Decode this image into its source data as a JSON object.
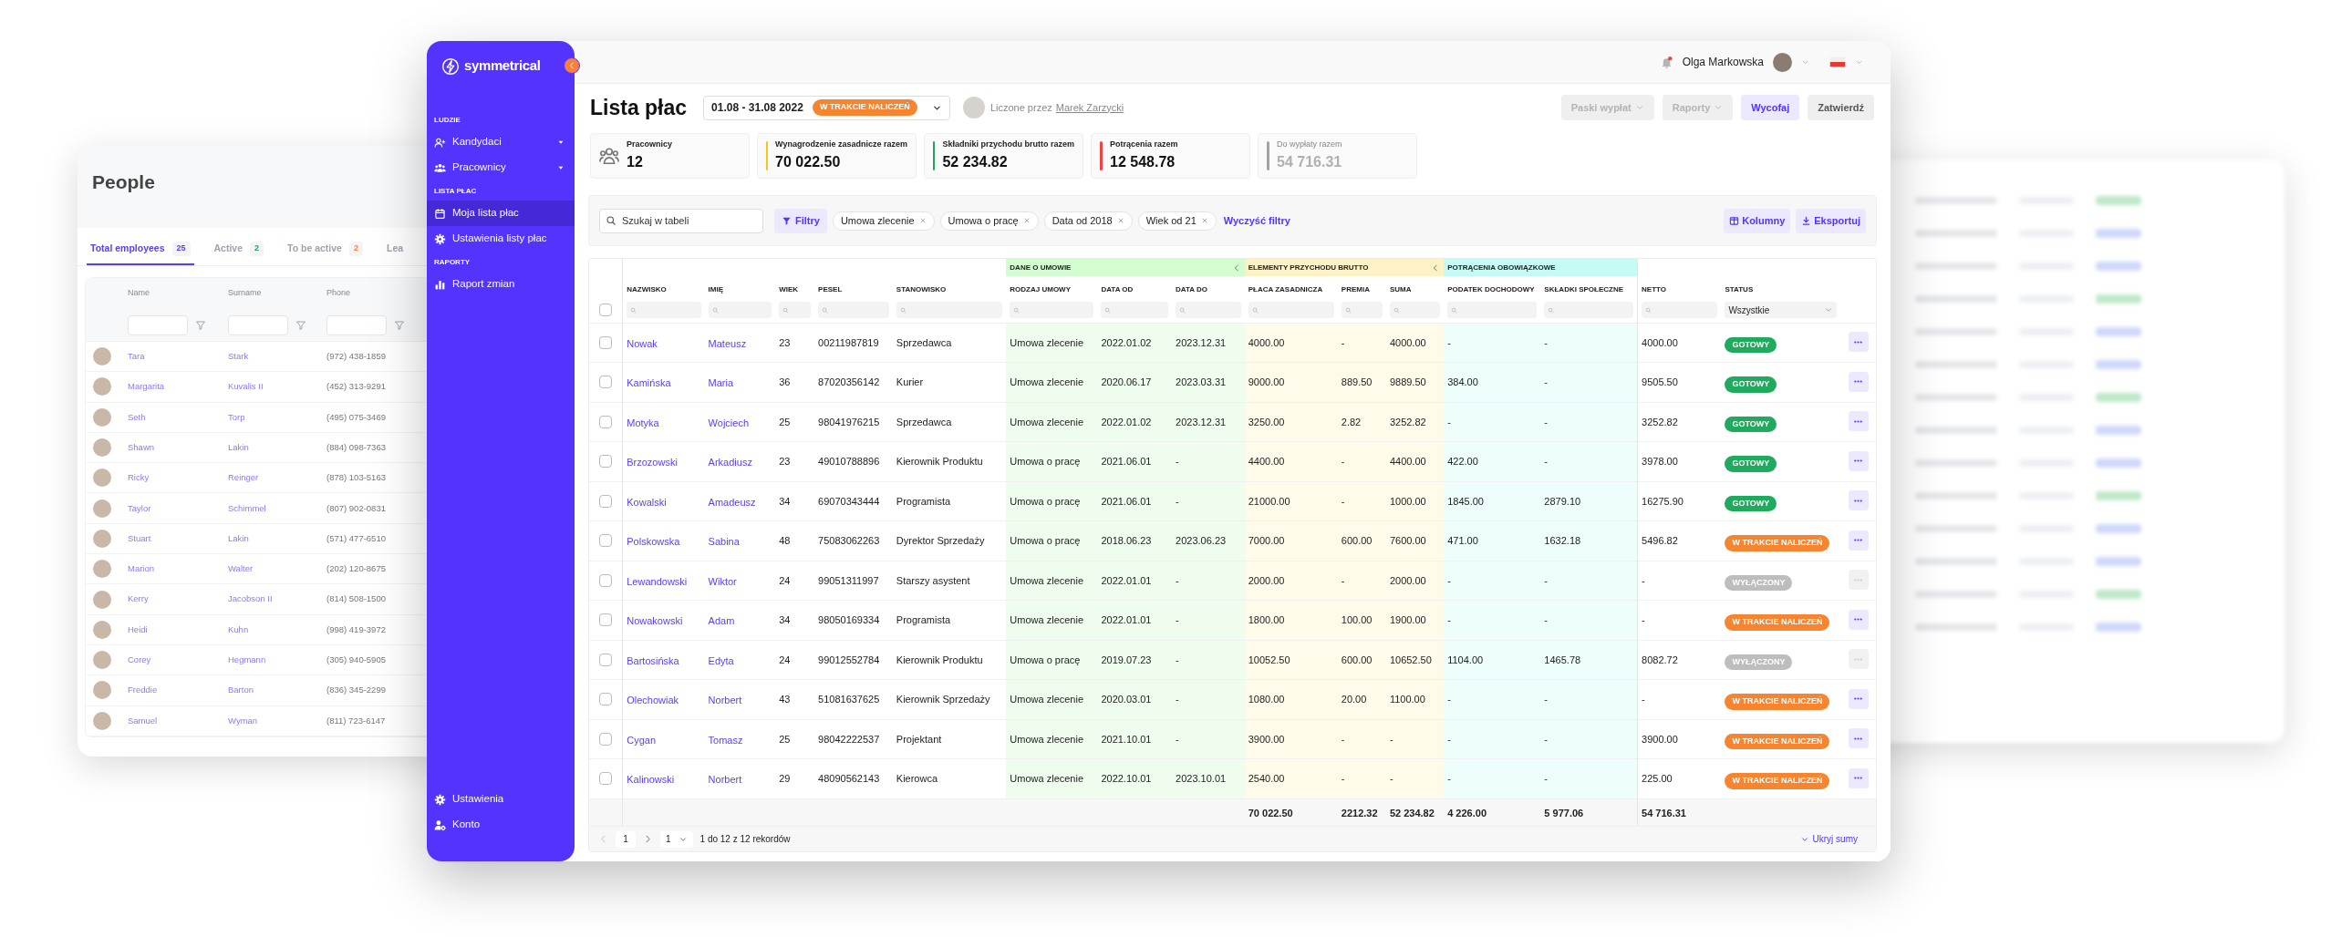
{
  "people_window": {
    "title": "People",
    "tabs": [
      {
        "label": "Total employees",
        "count": "25",
        "color": "#5b3df5",
        "selected": true
      },
      {
        "label": "Active",
        "count": "2",
        "color": "#22a55a",
        "selected": false
      },
      {
        "label": "To be active",
        "count": "2",
        "color": "#f7852f",
        "selected": false
      },
      {
        "label": "Lea",
        "selected": false
      }
    ],
    "columns": [
      "Name",
      "Surname",
      "Phone"
    ],
    "rows": [
      {
        "name": "Tara",
        "surname": "Stark",
        "phone": "(972) 438-1859"
      },
      {
        "name": "Margarita",
        "surname": "Kuvalis II",
        "phone": "(452) 313-9291"
      },
      {
        "name": "Seth",
        "surname": "Torp",
        "phone": "(495) 075-3469"
      },
      {
        "name": "Shawn",
        "surname": "Lakin",
        "phone": "(884) 098-7363"
      },
      {
        "name": "Ricky",
        "surname": "Reinger",
        "phone": "(878) 103-5163"
      },
      {
        "name": "Taylor",
        "surname": "Schimmel",
        "phone": "(807) 902-0831"
      },
      {
        "name": "Stuart",
        "surname": "Lakin",
        "phone": "(571) 477-6510"
      },
      {
        "name": "Marion",
        "surname": "Walter",
        "phone": "(202) 120-8675"
      },
      {
        "name": "Kerry",
        "surname": "Jacobson II",
        "phone": "(814) 508-1500"
      },
      {
        "name": "Heidi",
        "surname": "Kuhn",
        "phone": "(998) 419-3972"
      },
      {
        "name": "Corey",
        "surname": "Hegmann",
        "phone": "(305) 940-5905"
      },
      {
        "name": "Freddie",
        "surname": "Barton",
        "phone": "(836) 345-2299"
      },
      {
        "name": "Samuel",
        "surname": "Wyman",
        "phone": "(811) 723-6147"
      }
    ]
  },
  "sidebar": {
    "logo": "symmetrical",
    "sections": [
      {
        "heading": "LUDZIE",
        "items": [
          {
            "label": "Kandydaci",
            "expandable": true,
            "selected": false
          },
          {
            "label": "Pracownicy",
            "expandable": true,
            "selected": false
          }
        ]
      },
      {
        "heading": "LISTA PŁAC",
        "items": [
          {
            "label": "Moja lista płac",
            "expandable": false,
            "selected": true
          },
          {
            "label": "Ustawienia listy płac",
            "expandable": false,
            "selected": false
          }
        ]
      },
      {
        "heading": "RAPORTY",
        "items": [
          {
            "label": "Raport zmian",
            "expandable": false,
            "selected": false
          }
        ]
      }
    ],
    "bottom_items": [
      {
        "label": "Ustawienia",
        "selected": false
      },
      {
        "label": "Konto",
        "selected": false
      }
    ]
  },
  "topbar": {
    "user_name": "Olga Markowska",
    "has_notification": true
  },
  "header": {
    "title": "Lista płac",
    "period": "01.08 - 31.08 2022",
    "period_status": {
      "label": "W TRAKCIE NALICZEŃ",
      "kind": "in_progress"
    },
    "counted_by_label": "Liczone przez",
    "counted_by_name": "Marek Zarzycki",
    "buttons": [
      {
        "label": "Paski wypłat",
        "kind": "menu",
        "disabled": true
      },
      {
        "label": "Raporty",
        "kind": "menu",
        "disabled": true
      },
      {
        "label": "Wycofaj",
        "kind": "primary",
        "disabled": false
      },
      {
        "label": "Zatwierdź",
        "kind": "secondary",
        "disabled": false
      }
    ]
  },
  "stats": [
    {
      "label": "Pracownicy",
      "value": "12",
      "kind": "icon",
      "disabled": false
    },
    {
      "label": "Wynagrodzenie zasadnicze razem",
      "value": "70 022.50",
      "kind": "bar",
      "color": "#f5c518",
      "disabled": false
    },
    {
      "label": "Składniki przychodu brutto razem",
      "value": "52 234.82",
      "kind": "bar",
      "color": "#22a55a",
      "disabled": false
    },
    {
      "label": "Potrącenia razem",
      "value": "12 548.78",
      "kind": "bar",
      "color": "#ef4444",
      "disabled": false
    },
    {
      "label": "Do wypłaty razem",
      "value": "54 716.31",
      "kind": "bar",
      "color": "#a3a3a3",
      "disabled": true
    }
  ],
  "filters": {
    "search_placeholder": "Szukaj w tabeli",
    "filter_button": "Filtry",
    "chips": [
      "Umowa zlecenie",
      "Umowa o pracę",
      "Data od 2018",
      "Wiek od 21"
    ],
    "clear": "Wyczyść filtry",
    "columns_button": "Kolumny",
    "export_button": "Eksportuj"
  },
  "table": {
    "column_groups": [
      {
        "label": "DANE O UMOWIE",
        "color": "#d3fcd0",
        "collapsible": true
      },
      {
        "label": "ELEMENTY PRZYCHODU BRUTTO",
        "color": "#fdf1c6",
        "collapsible": true
      },
      {
        "label": "POTRĄCENIA OBOWIĄZKOWE",
        "color": "#c6fbf5",
        "collapsible": false
      }
    ],
    "columns": [
      {
        "kind": "checkbox",
        "checked": false
      },
      {
        "label": "NAZWISKO",
        "kind": "link"
      },
      {
        "label": "IMIĘ",
        "kind": "link"
      },
      {
        "label": "WIEK",
        "kind": "text"
      },
      {
        "label": "PESEL",
        "kind": "text"
      },
      {
        "label": "STANOWISKO",
        "kind": "text"
      },
      {
        "label": "RODZAJ UMOWY",
        "kind": "text",
        "color": "#effdee"
      },
      {
        "label": "DATA OD",
        "kind": "text",
        "color": "#effdee"
      },
      {
        "label": "DATA DO",
        "kind": "text",
        "color": "#effdee"
      },
      {
        "label": "PŁACA ZASADNICZA",
        "kind": "text",
        "color": "#fffbeb",
        "total": "70 022.50"
      },
      {
        "label": "PREMIA",
        "kind": "text",
        "color": "#fffbeb",
        "total": "2212.32"
      },
      {
        "label": "SUMA",
        "kind": "text",
        "color": "#fffbeb",
        "total": "52 234.82"
      },
      {
        "label": "PODATEK DOCHODOWY",
        "kind": "text",
        "color": "#edfefc",
        "total": "4 226.00"
      },
      {
        "label": "SKŁADKI SPOŁECZNE",
        "kind": "text",
        "color": "#edfefc",
        "total": "5 977.06"
      },
      {
        "label": "NETTO",
        "kind": "text",
        "total": "54 716.31"
      },
      {
        "label": "STATUS",
        "kind": "status",
        "filter_value": "Wszystkie"
      }
    ],
    "rows": [
      {
        "cells": [
          {
            "checked": false
          },
          "Nowak",
          "Mateusz",
          "23",
          "00211987819",
          "Sprzedawca",
          "Umowa zlecenie",
          "2022.01.02",
          "2023.12.31",
          "4000.00",
          "-",
          "4000.00",
          "-",
          "-",
          "4000.00"
        ],
        "status": {
          "label": "GOTOWY",
          "kind": "ready"
        }
      },
      {
        "cells": [
          {
            "checked": false
          },
          "Kamińska",
          "Maria",
          "36",
          "87020356142",
          "Kurier",
          "Umowa zlecenie",
          "2020.06.17",
          "2023.03.31",
          "9000.00",
          "889.50",
          "9889.50",
          "384.00",
          "-",
          "9505.50"
        ],
        "status": {
          "label": "GOTOWY",
          "kind": "ready"
        }
      },
      {
        "cells": [
          {
            "checked": false
          },
          "Motyka",
          "Wojciech",
          "25",
          "98041976215",
          "Sprzedawca",
          "Umowa zlecenie",
          "2022.01.02",
          "2023.12.31",
          "3250.00",
          "2.82",
          "3252.82",
          "-",
          "-",
          "3252.82"
        ],
        "status": {
          "label": "GOTOWY",
          "kind": "ready"
        }
      },
      {
        "cells": [
          {
            "checked": false
          },
          "Brzozowski",
          "Arkadiusz",
          "23",
          "49010788896",
          "Kierownik Produktu",
          "Umowa o pracę",
          "2021.06.01",
          "-",
          "4400.00",
          "-",
          "4400.00",
          "422.00",
          "-",
          "3978.00"
        ],
        "status": {
          "label": "GOTOWY",
          "kind": "ready"
        }
      },
      {
        "cells": [
          {
            "checked": false
          },
          "Kowalski",
          "Amadeusz",
          "34",
          "69070343444",
          "Programista",
          "Umowa o pracę",
          "2021.06.01",
          "-",
          "21000.00",
          "-",
          "1000.00",
          "1845.00",
          "2879.10",
          "16275.90"
        ],
        "status": {
          "label": "GOTOWY",
          "kind": "ready"
        }
      },
      {
        "cells": [
          {
            "checked": false
          },
          "Polskowska",
          "Sabina",
          "48",
          "75083062263",
          "Dyrektor Sprzedaży",
          "Umowa o pracę",
          "2018.06.23",
          "2023.06.23",
          "7000.00",
          "600.00",
          "7600.00",
          "471.00",
          "1632.18",
          "5496.82"
        ],
        "status": {
          "label": "W TRAKCIE NALICZEŃ",
          "kind": "in_progress"
        }
      },
      {
        "cells": [
          {
            "checked": false
          },
          "Lewandowski",
          "Wiktor",
          "24",
          "99051311997",
          "Starszy asystent",
          "Umowa zlecenie",
          "2022.01.01",
          "-",
          "2000.00",
          "-",
          "2000.00",
          "-",
          "-",
          "-"
        ],
        "status": {
          "label": "WYŁĄCZONY",
          "kind": "disabled"
        }
      },
      {
        "cells": [
          {
            "checked": false
          },
          "Nowakowski",
          "Adam",
          "34",
          "98050169334",
          "Programista",
          "Umowa zlecenie",
          "2022.01.01",
          "-",
          "1800.00",
          "100.00",
          "1900.00",
          "-",
          "-",
          "-"
        ],
        "status": {
          "label": "W TRAKCIE NALICZEŃ",
          "kind": "in_progress"
        }
      },
      {
        "cells": [
          {
            "checked": false
          },
          "Bartosińska",
          "Edyta",
          "24",
          "99012552784",
          "Kierownik Produktu",
          "Umowa o pracę",
          "2019.07.23",
          "-",
          "10052.50",
          "600.00",
          "10652.50",
          "1104.00",
          "1465.78",
          "8082.72"
        ],
        "status": {
          "label": "WYŁĄCZONY",
          "kind": "disabled"
        }
      },
      {
        "cells": [
          {
            "checked": false
          },
          "Olechowiak",
          "Norbert",
          "43",
          "51081637625",
          "Kierownik Sprzedaży",
          "Umowa zlecenie",
          "2020.03.01",
          "-",
          "1080.00",
          "20.00",
          "1100.00",
          "-",
          "-",
          "-"
        ],
        "status": {
          "label": "W TRAKCIE NALICZEŃ",
          "kind": "in_progress"
        }
      },
      {
        "cells": [
          {
            "checked": false
          },
          "Cygan",
          "Tomasz",
          "25",
          "98042222537",
          "Projektant",
          "Umowa zlecenie",
          "2021.10.01",
          "-",
          "3900.00",
          "-",
          "-",
          "-",
          "-",
          "3900.00"
        ],
        "status": {
          "label": "W TRAKCIE NALICZEŃ",
          "kind": "in_progress"
        }
      },
      {
        "cells": [
          {
            "checked": false
          },
          "Kalinowski",
          "Norbert",
          "29",
          "48090562143",
          "Kierowca",
          "Umowa zlecenie",
          "2022.10.01",
          "2023.10.01",
          "2540.00",
          "-",
          "-",
          "-",
          "-",
          "225.00"
        ],
        "status": {
          "label": "W TRAKCIE NALICZEŃ",
          "kind": "in_progress"
        }
      }
    ],
    "pagination": {
      "page": "1",
      "page_size": "1",
      "info": "1 do 12 z 12 rekordów"
    },
    "hide_totals": "Ukryj sumy"
  }
}
